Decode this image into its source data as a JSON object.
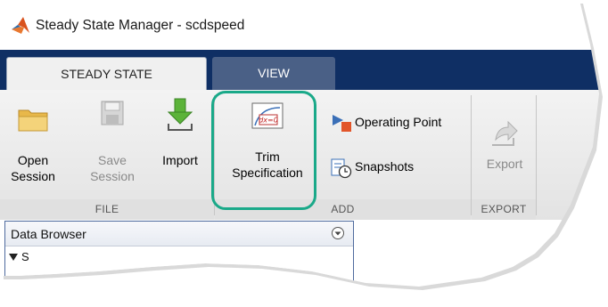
{
  "window": {
    "title": "Steady State Manager - scdspeed",
    "app_icon": "matlab-logo-icon"
  },
  "tabs": [
    {
      "label": "STEADY STATE",
      "active": true
    },
    {
      "label": "VIEW",
      "active": false
    }
  ],
  "ribbon": {
    "file_group": {
      "label": "FILE",
      "open": {
        "line1": "Open",
        "line2": "Session",
        "icon": "folder-icon"
      },
      "save": {
        "line1": "Save",
        "line2": "Session",
        "icon": "floppy-disk-icon",
        "disabled": true
      },
      "import": {
        "label": "Import",
        "icon": "import-arrow-icon"
      }
    },
    "add_group": {
      "label": "ADD",
      "trim": {
        "line1": "Trim",
        "line2": "Specification",
        "icon": "trim-specification-icon",
        "icon_text": "dx=0"
      },
      "operating_point": {
        "label": "Operating Point",
        "icon": "operating-point-icon"
      },
      "snapshots": {
        "label": "Snapshots",
        "icon": "snapshots-icon"
      }
    },
    "export_group": {
      "label": "EXPORT",
      "export": {
        "label": "Export",
        "icon": "export-arrow-icon",
        "disabled": true
      }
    }
  },
  "data_browser": {
    "title": "Data Browser",
    "menu_icon": "chevron-down-circle-icon",
    "first_row": "S"
  },
  "colors": {
    "tab_strip": "#0f2f64",
    "inactive_tab": "#4a6086",
    "highlight": "#1aa989",
    "matlab_orange": "#d9531e"
  }
}
